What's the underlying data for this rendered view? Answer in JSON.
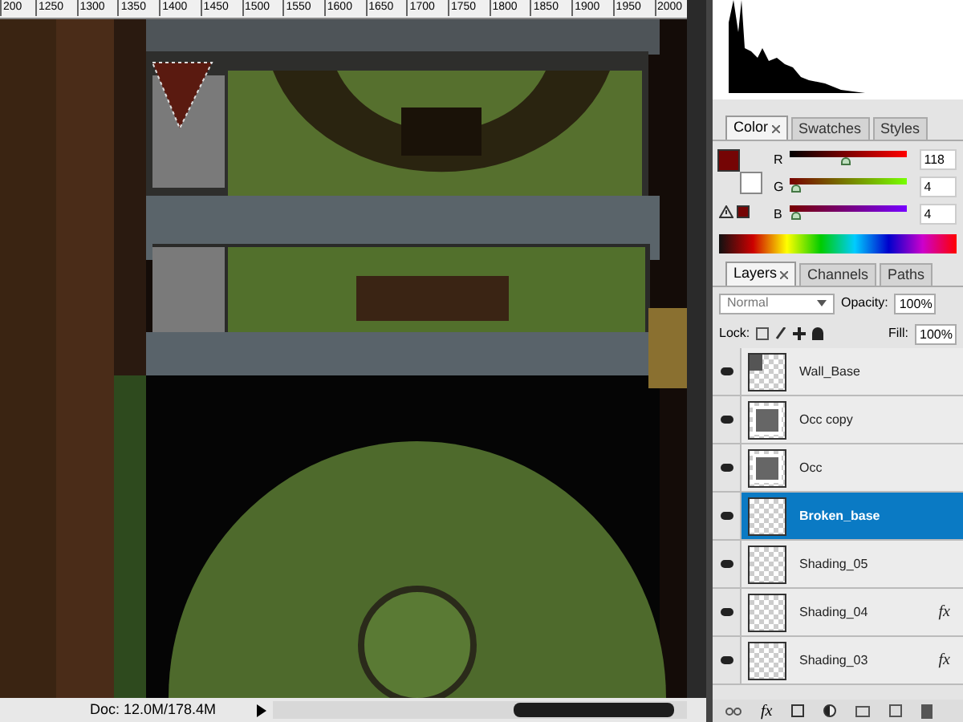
{
  "ruler": {
    "labels": [
      "200",
      "1250",
      "1300",
      "1350",
      "1400",
      "1450",
      "1500",
      "1550",
      "1600",
      "1650",
      "1700",
      "1750",
      "1800",
      "1850",
      "1900",
      "1950",
      "2000"
    ]
  },
  "status_bar": {
    "doc": "Doc: 12.0M/178.4M"
  },
  "color_panel": {
    "tabs": [
      {
        "label": "Color",
        "selected": true
      },
      {
        "label": "Swatches",
        "selected": false
      },
      {
        "label": "Styles",
        "selected": false
      }
    ],
    "channels": [
      {
        "label": "R",
        "level": 0.46,
        "value": "118"
      },
      {
        "label": "G",
        "level": 0.02,
        "value": "4"
      },
      {
        "label": "B",
        "level": 0.02,
        "value": "4"
      }
    ]
  },
  "layers_panel": {
    "tabs": [
      {
        "label": "Layers",
        "selected": true
      },
      {
        "label": "Channels",
        "selected": false
      },
      {
        "label": "Paths",
        "selected": false
      }
    ],
    "blend_mode": "Normal",
    "opacity_label": "Opacity:",
    "opacity": "100%",
    "lock_label": "Lock:",
    "fill_label": "Fill:",
    "fill": "100%",
    "footer_effects": "fx",
    "layers": [
      {
        "name": "Wall_Base",
        "selected": false,
        "kind": "partial"
      },
      {
        "name": "Occ copy",
        "selected": false,
        "kind": "full"
      },
      {
        "name": "Occ",
        "selected": false,
        "kind": "full"
      },
      {
        "name": "Broken_base",
        "selected": true,
        "kind": "empty"
      },
      {
        "name": "Shading_05",
        "selected": false,
        "kind": "empty"
      },
      {
        "name": "Shading_04",
        "selected": false,
        "kind": "empty",
        "effects": "fx"
      },
      {
        "name": "Shading_03",
        "selected": false,
        "kind": "empty",
        "effects": "fx"
      }
    ]
  }
}
